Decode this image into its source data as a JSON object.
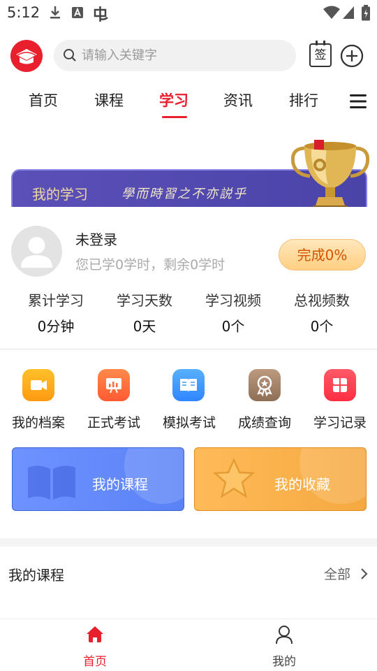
{
  "status_bar": {
    "time": "5:12"
  },
  "header": {
    "search_placeholder": "请输入关键字",
    "sign_label": "签"
  },
  "tabs": [
    {
      "label": "首页"
    },
    {
      "label": "课程"
    },
    {
      "label": "学习",
      "active": true
    },
    {
      "label": "资讯"
    },
    {
      "label": "排行"
    }
  ],
  "banner": {
    "title": "我的学习",
    "motto": "學而時習之不亦説乎"
  },
  "user": {
    "name": "未登录",
    "summary": "您已学0学时，剩余0学时",
    "complete_label": "完成0%",
    "progress_percent": 0
  },
  "stats": [
    {
      "label": "累计学习",
      "value": "0分钟"
    },
    {
      "label": "学习天数",
      "value": "0天"
    },
    {
      "label": "学习视频",
      "value": "0个"
    },
    {
      "label": "总视频数",
      "value": "0个"
    }
  ],
  "functions": [
    {
      "label": "我的档案",
      "icon": "video-camera-icon",
      "color": "#ffa21a"
    },
    {
      "label": "正式考试",
      "icon": "chart-board-icon",
      "color": "#ff6a3d"
    },
    {
      "label": "模拟考试",
      "icon": "open-book-icon",
      "color": "#3c9cff"
    },
    {
      "label": "成绩查询",
      "icon": "award-badge-icon",
      "color": "#a4826a"
    },
    {
      "label": "学习记录",
      "icon": "grid-petals-icon",
      "color": "#ff3a4f"
    }
  ],
  "cards": [
    {
      "label": "我的课程",
      "icon": "book-icon"
    },
    {
      "label": "我的收藏",
      "icon": "star-icon"
    }
  ],
  "section": {
    "title": "我的课程",
    "more": "全部"
  },
  "bottom_nav": [
    {
      "label": "首页",
      "active": true,
      "color": "#e8202e"
    },
    {
      "label": "我的",
      "active": false
    }
  ]
}
